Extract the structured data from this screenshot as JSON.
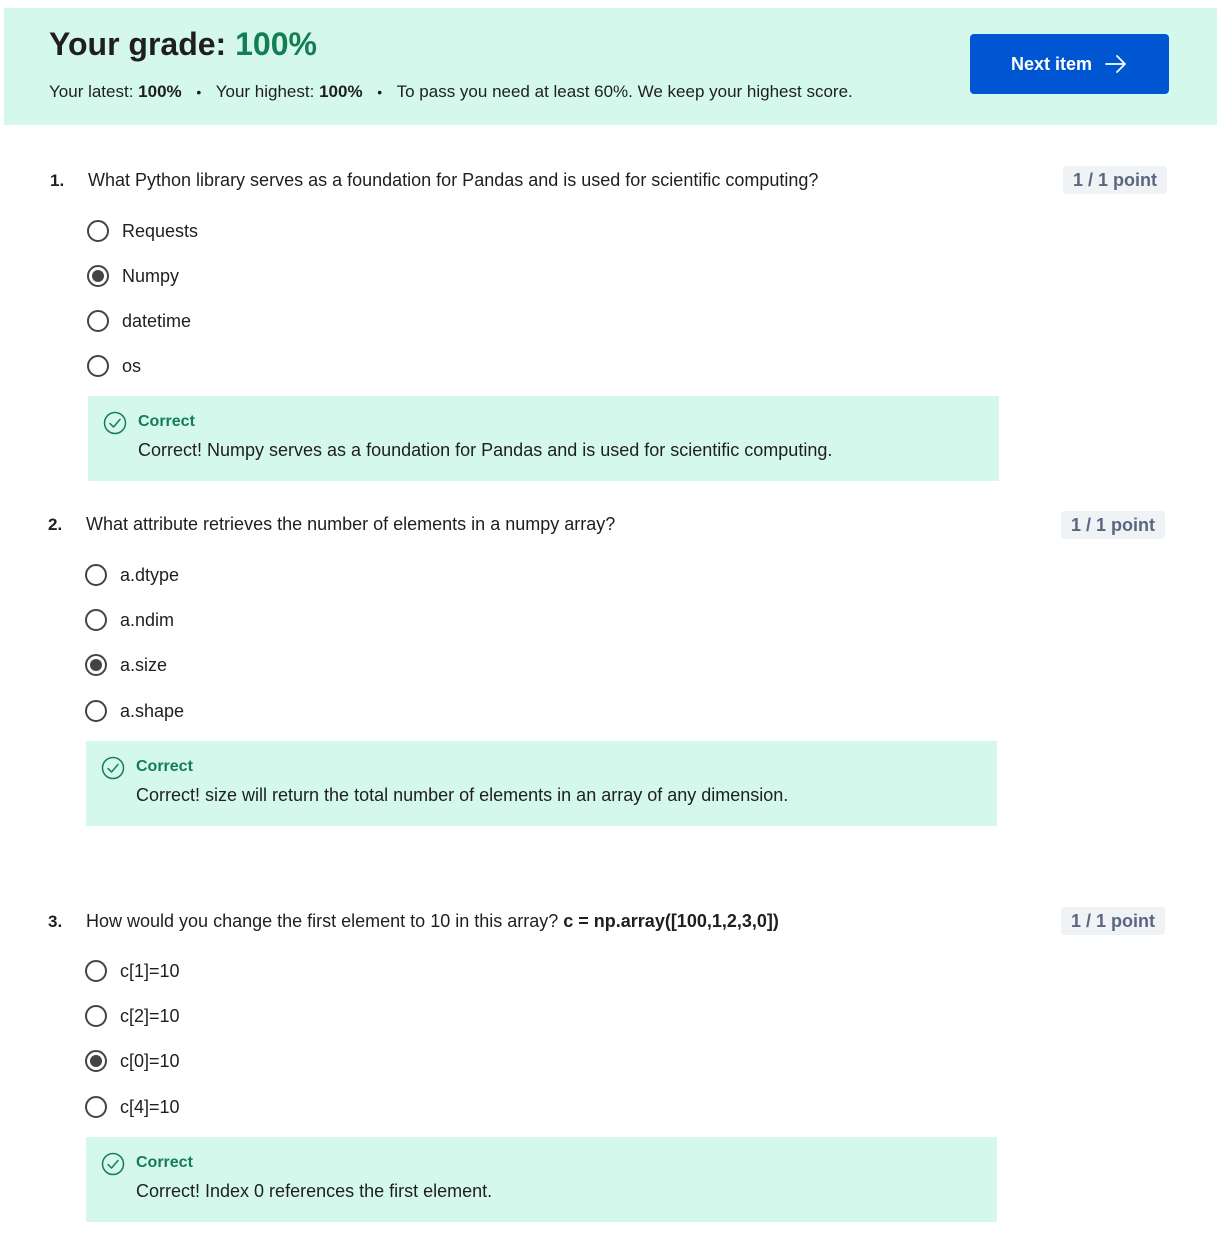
{
  "grade": {
    "title_prefix": "Your grade:",
    "value": "100%",
    "latest_label": "Your latest:",
    "latest_value": "100%",
    "highest_label": "Your highest:",
    "highest_value": "100%",
    "pass_note": "To pass you need at least 60%. We keep your highest score.",
    "separator": "•"
  },
  "next_button": {
    "label": "Next item",
    "icon": "arrow-right-icon"
  },
  "colors": {
    "banner_bg": "#d5f8ec",
    "grade_green": "#137d55",
    "button_blue": "#0056d2",
    "feedback_bg": "#d5f8ec"
  },
  "questions": [
    {
      "number": "1.",
      "text": "What Python library serves as a foundation for Pandas and is used for scientific computing?",
      "code": "",
      "points": "1 / 1 point",
      "options": [
        {
          "label": "Requests",
          "selected": false
        },
        {
          "label": "Numpy",
          "selected": true
        },
        {
          "label": "datetime",
          "selected": false
        },
        {
          "label": "os",
          "selected": false
        }
      ],
      "feedback": {
        "status": "Correct",
        "message": "Correct! Numpy serves as a foundation for Pandas and is used for scientific computing.",
        "icon": "check-circle-icon"
      }
    },
    {
      "number": "2.",
      "text": "What attribute retrieves the number of elements in a numpy array?",
      "code": "",
      "points": "1 / 1 point",
      "options": [
        {
          "label": "a.dtype",
          "selected": false
        },
        {
          "label": "a.ndim",
          "selected": false
        },
        {
          "label": "a.size",
          "selected": true
        },
        {
          "label": "a.shape",
          "selected": false
        }
      ],
      "feedback": {
        "status": "Correct",
        "message": "Correct! size will return the total number of elements in an array of any dimension.",
        "icon": "check-circle-icon"
      }
    },
    {
      "number": "3.",
      "text": "How would you change the first element to 10 in this array? ",
      "code": "c = np.array([100,1,2,3,0])",
      "points": "1 / 1 point",
      "options": [
        {
          "label": "c[1]=10",
          "selected": false
        },
        {
          "label": "c[2]=10",
          "selected": false
        },
        {
          "label": "c[0]=10",
          "selected": true
        },
        {
          "label": "c[4]=10",
          "selected": false
        }
      ],
      "feedback": {
        "status": "Correct",
        "message": "Correct! Index 0 references the first element.",
        "icon": "check-circle-icon"
      }
    }
  ]
}
